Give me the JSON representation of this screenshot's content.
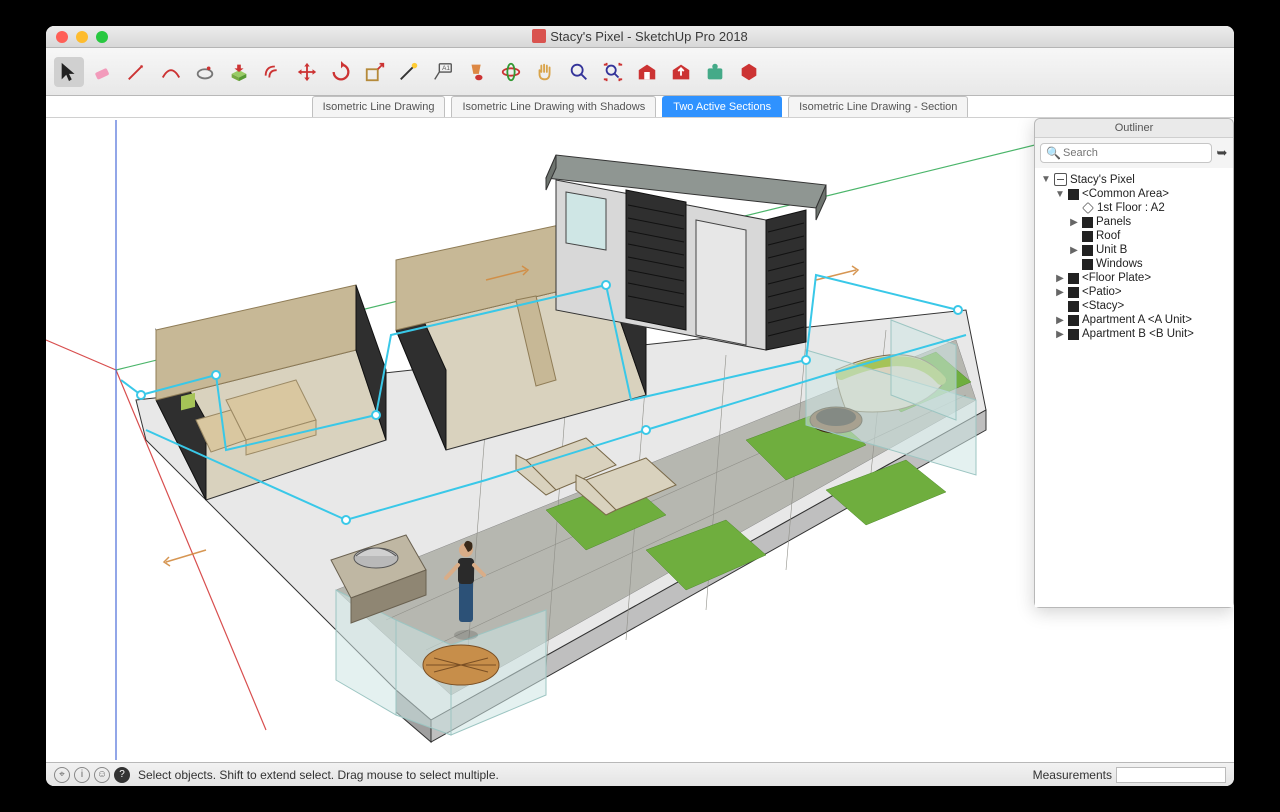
{
  "window": {
    "title": "Stacy's Pixel - SketchUp Pro 2018"
  },
  "toolbar": {
    "tools": [
      {
        "name": "select",
        "active": true
      },
      {
        "name": "eraser"
      },
      {
        "name": "line"
      },
      {
        "name": "arc"
      },
      {
        "name": "shapes"
      },
      {
        "name": "pushpull"
      },
      {
        "name": "offset"
      },
      {
        "name": "move"
      },
      {
        "name": "rotate"
      },
      {
        "name": "scale"
      },
      {
        "name": "tape"
      },
      {
        "name": "text"
      },
      {
        "name": "paint"
      },
      {
        "name": "orbit"
      },
      {
        "name": "pan"
      },
      {
        "name": "zoom"
      },
      {
        "name": "zoom-extents"
      },
      {
        "name": "warehouse-get"
      },
      {
        "name": "warehouse-share"
      },
      {
        "name": "extensions"
      },
      {
        "name": "layout"
      }
    ]
  },
  "scenes": {
    "tabs": [
      {
        "label": "Isometric Line Drawing",
        "active": false
      },
      {
        "label": "Isometric Line Drawing with Shadows",
        "active": false
      },
      {
        "label": "Two Active Sections",
        "active": true
      },
      {
        "label": "Isometric Line Drawing - Section",
        "active": false
      }
    ]
  },
  "outliner": {
    "title": "Outliner",
    "search_placeholder": "Search",
    "tree": [
      {
        "depth": 0,
        "toggle": "▼",
        "icon": "model",
        "label": "Stacy's Pixel"
      },
      {
        "depth": 1,
        "toggle": "▼",
        "icon": "comp",
        "label": "<Common Area>"
      },
      {
        "depth": 2,
        "toggle": "",
        "icon": "sec",
        "label": "1st Floor : A2"
      },
      {
        "depth": 2,
        "toggle": "▶",
        "icon": "comp",
        "label": "Panels"
      },
      {
        "depth": 2,
        "toggle": "",
        "icon": "comp",
        "label": "Roof"
      },
      {
        "depth": 2,
        "toggle": "▶",
        "icon": "comp",
        "label": "Unit B"
      },
      {
        "depth": 2,
        "toggle": "",
        "icon": "comp",
        "label": "Windows"
      },
      {
        "depth": 1,
        "toggle": "▶",
        "icon": "comp",
        "label": "<Floor Plate>"
      },
      {
        "depth": 1,
        "toggle": "▶",
        "icon": "comp",
        "label": "<Patio>"
      },
      {
        "depth": 1,
        "toggle": "",
        "icon": "comp",
        "label": "<Stacy>"
      },
      {
        "depth": 1,
        "toggle": "▶",
        "icon": "comp",
        "label": "Apartment A <A Unit>"
      },
      {
        "depth": 1,
        "toggle": "▶",
        "icon": "comp",
        "label": "Apartment B <B Unit>"
      }
    ]
  },
  "status": {
    "hint": "Select objects. Shift to extend select. Drag mouse to select multiple.",
    "measurements_label": "Measurements"
  },
  "colors": {
    "axis_red": "#d84e4e",
    "axis_green": "#4bb56a",
    "axis_blue": "#4a6bd8",
    "section": "#39c8e8",
    "grass": "#6fae3e",
    "stone": "#b6b7b0",
    "wall_dark": "#2f2f2f",
    "wall_light": "#c7b896",
    "deck": "#c78e4a",
    "cushion": "#a6c357",
    "glass": "#cde5e3",
    "roof": "#8f9692",
    "floor": "#d9d2be"
  }
}
